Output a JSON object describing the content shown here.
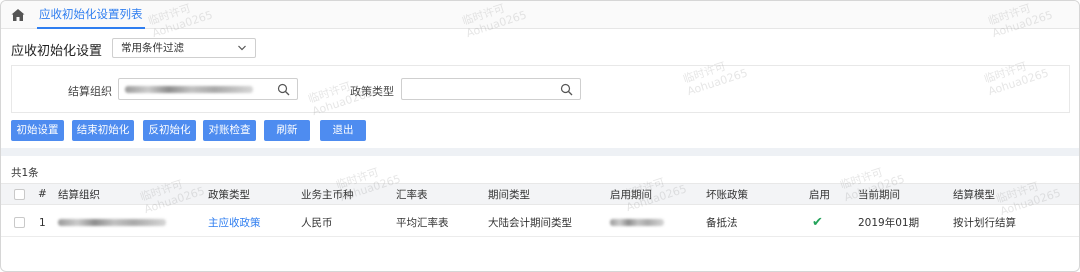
{
  "tab": {
    "label": "应收初始化设置列表"
  },
  "header": {
    "title": "应收初始化设置",
    "filter_select": "常用条件过滤"
  },
  "filters": {
    "settle_org_label": "结算组织",
    "policy_type_label": "政策类型",
    "policy_type_value": ""
  },
  "toolbar": {
    "buttons": [
      "初始设置",
      "结束初始化",
      "反初始化",
      "对账检查",
      "刷新",
      "退出"
    ]
  },
  "summary": {
    "count": "共1条"
  },
  "table": {
    "columns": [
      "#",
      "结算组织",
      "政策类型",
      "业务主币种",
      "汇率表",
      "期间类型",
      "启用期间",
      "坏账政策",
      "启用",
      "当前期间",
      "结算模型"
    ],
    "rows": [
      {
        "index": "1",
        "policy_type": "主应收政策",
        "currency": "人民币",
        "rate_table": "平均汇率表",
        "period_type": "大陆会计期间类型",
        "bad_debt_policy": "备抵法",
        "enabled": "✔",
        "current_period": "2019年01期",
        "settle_model": "按计划行结算"
      }
    ]
  },
  "watermark": {
    "line1": "临时许可",
    "line2": "Aohua0265"
  },
  "colors": {
    "accent": "#2f7ef0",
    "button": "#4e8cf0",
    "enabled_check": "#23a35a"
  }
}
